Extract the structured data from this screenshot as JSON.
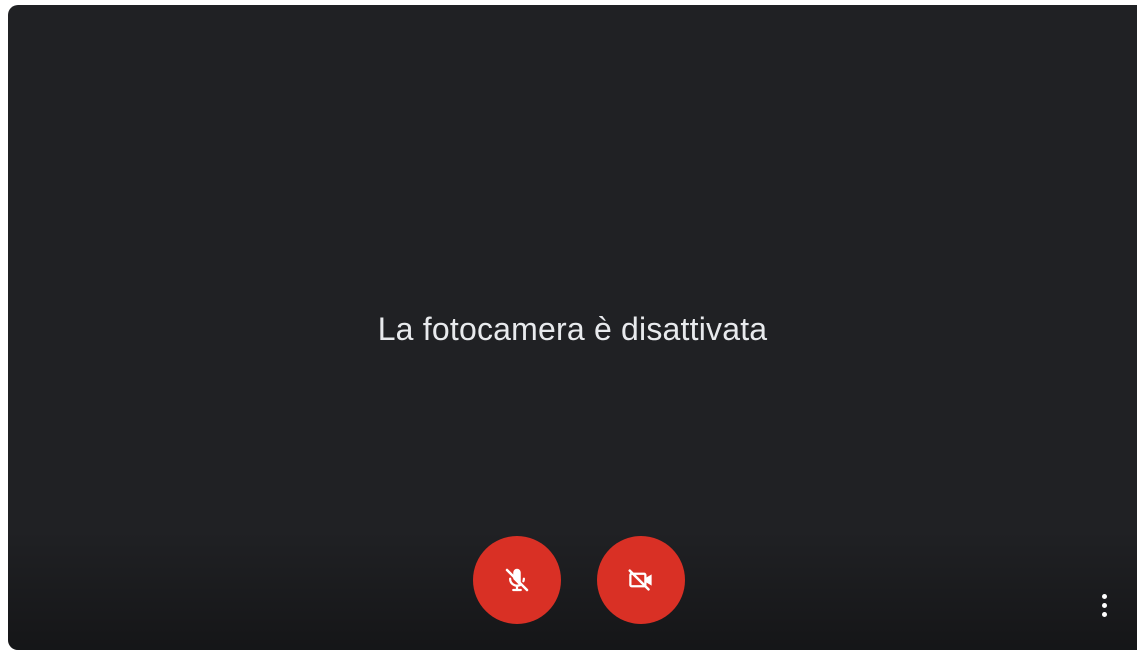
{
  "preview": {
    "status_text": "La fotocamera è disattivata"
  },
  "controls": {
    "mic": {
      "icon": "mic-off-icon",
      "state": "off"
    },
    "camera": {
      "icon": "videocam-off-icon",
      "state": "off"
    },
    "more": {
      "icon": "more-vert-icon"
    }
  },
  "colors": {
    "background": "#202124",
    "button_off": "#d93025",
    "text": "#e8eaed",
    "icon": "#ffffff"
  }
}
